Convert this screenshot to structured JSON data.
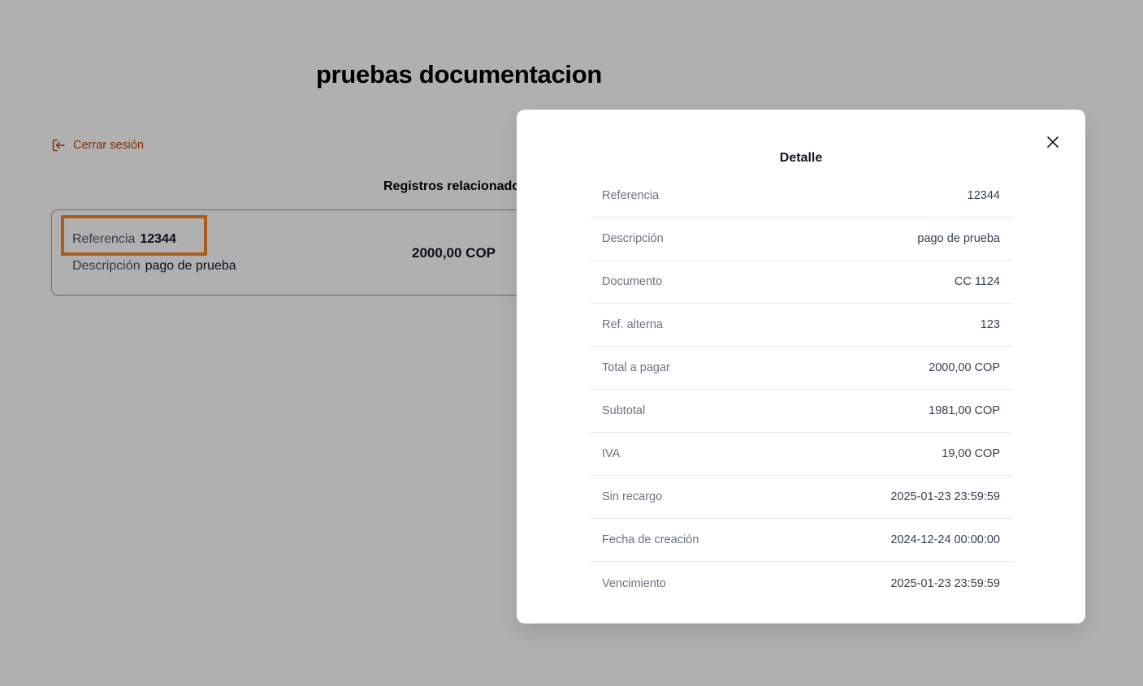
{
  "page": {
    "title": "pruebas documentacion",
    "logout_label": "Cerrar sesión",
    "section_title": "Registros relacionados"
  },
  "record": {
    "reference_label": "Referencia",
    "reference_value": "12344",
    "description_label": "Descripción",
    "description_value": "pago de prueba",
    "amount": "2000,00 COP"
  },
  "modal": {
    "title": "Detalle",
    "rows": [
      {
        "label": "Referencia",
        "value": "12344"
      },
      {
        "label": "Descripción",
        "value": "pago de prueba"
      },
      {
        "label": "Documento",
        "value": "CC 1124"
      },
      {
        "label": "Ref. alterna",
        "value": "123"
      },
      {
        "label": "Total a pagar",
        "value": "2000,00 COP"
      },
      {
        "label": "Subtotal",
        "value": "1981,00 COP"
      },
      {
        "label": "IVA",
        "value": "19,00 COP"
      },
      {
        "label": "Sin recargo",
        "value": "2025-01-23 23:59:59"
      },
      {
        "label": "Fecha de creación",
        "value": "2024-12-24 00:00:00"
      },
      {
        "label": "Vencimiento",
        "value": "2025-01-23 23:59:59"
      }
    ]
  },
  "colors": {
    "accent": "#c2410c",
    "highlight": "#f7862e",
    "overlay": "rgba(0,0,0,0.31)"
  },
  "icons": {
    "logout": "logout-icon",
    "close": "close-icon"
  }
}
